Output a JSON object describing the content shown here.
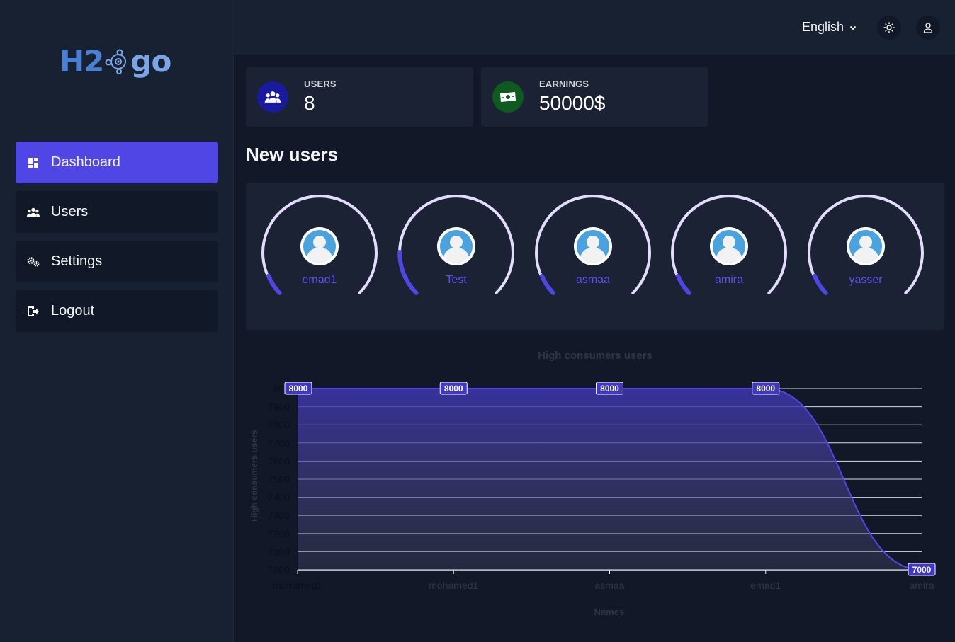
{
  "brand": {
    "logo_part1": "H2",
    "logo_part2": "go"
  },
  "sidebar": {
    "items": [
      {
        "label": "Dashboard",
        "icon": "dashboard-icon",
        "active": true
      },
      {
        "label": "Users",
        "icon": "users-icon",
        "active": false
      },
      {
        "label": "Settings",
        "icon": "gears-icon",
        "active": false
      },
      {
        "label": "Logout",
        "icon": "logout-icon",
        "active": false
      }
    ]
  },
  "topbar": {
    "language": "English",
    "theme_icon": "sun-icon",
    "profile_icon": "user-icon"
  },
  "stats": [
    {
      "label": "USERS",
      "value": "8",
      "icon": "users-icon",
      "icon_bg": "#1a1a9e"
    },
    {
      "label": "EARNINGS",
      "value": "50000$",
      "icon": "money-icon",
      "icon_bg": "#0f5a1e"
    }
  ],
  "new_users": {
    "title": "New users",
    "users": [
      {
        "name": "emad1"
      },
      {
        "name": "Test"
      },
      {
        "name": "asmaa"
      },
      {
        "name": "amira"
      },
      {
        "name": "yasser"
      }
    ]
  },
  "colors": {
    "accent": "#4f46e5",
    "gauge_track": "#e4dcff",
    "gauge_fill": "#4f46e5"
  },
  "chart_data": {
    "type": "area",
    "title": "High consumers users",
    "xlabel": "Names",
    "ylabel": "High consumers users",
    "categories": [
      "mohamed1",
      "mohamed1",
      "asmaa",
      "emad1",
      "amira"
    ],
    "series": [
      {
        "values": [
          8000,
          8000,
          8000,
          8000,
          7000
        ]
      }
    ],
    "data_labels": [
      "8000",
      "8000",
      "8000",
      "8000",
      "7000"
    ],
    "ylim": [
      7000,
      8000
    ],
    "yticks": [
      "7000",
      "7100",
      "7200",
      "7300",
      "7400",
      "7500",
      "7600",
      "7700",
      "7800",
      "7900",
      "800"
    ],
    "grid": true
  }
}
